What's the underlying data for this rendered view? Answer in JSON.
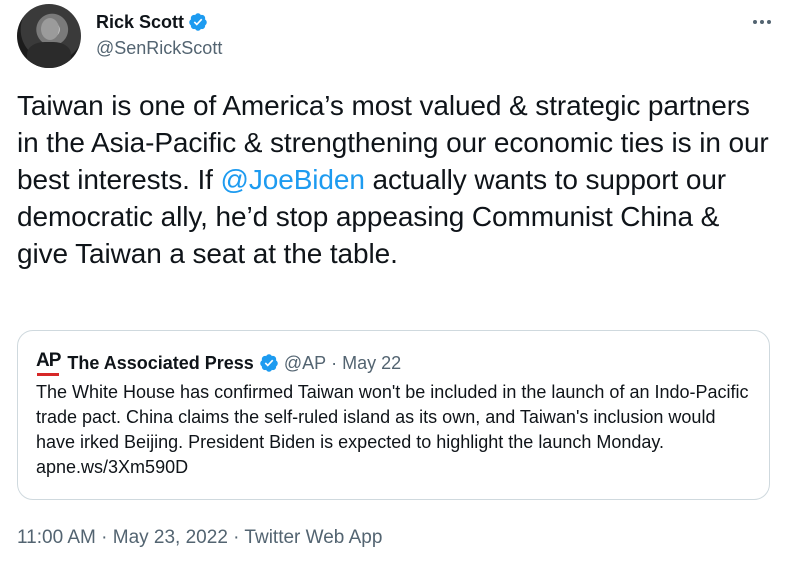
{
  "author": {
    "name": "Rick Scott",
    "handle": "@SenRickScott"
  },
  "tweet": {
    "text_part1": "Taiwan is one of America’s most valued & strategic partners in the Asia-Pacific & strengthening our economic ties is in our best interests. If ",
    "mention": "@JoeBiden",
    "text_part2": " actually wants to support our democratic ally, he’d stop appeasing Communist China & give Taiwan a seat at the table."
  },
  "quote": {
    "logo_text": "AP",
    "name": "The Associated Press",
    "handle": "@AP",
    "separator": "·",
    "date": "May 22",
    "text": "The White House has confirmed Taiwan won't be included in the launch of an Indo-Pacific trade pact. China claims the self-ruled island as its own, and Taiwan's inclusion would have irked Beijing. President Biden is expected to highlight the launch Monday. apne.ws/3Xm590D"
  },
  "footer": {
    "text": "11:00 AM · May 23, 2022 · Twitter Web App"
  },
  "colors": {
    "accent": "#1d9bf0",
    "text": "#0f1419",
    "muted": "#536471",
    "border": "#cfd9de",
    "ap_red": "#d62828"
  },
  "icons": [
    "verified-badge-icon",
    "more-options-icon",
    "ap-logo"
  ]
}
